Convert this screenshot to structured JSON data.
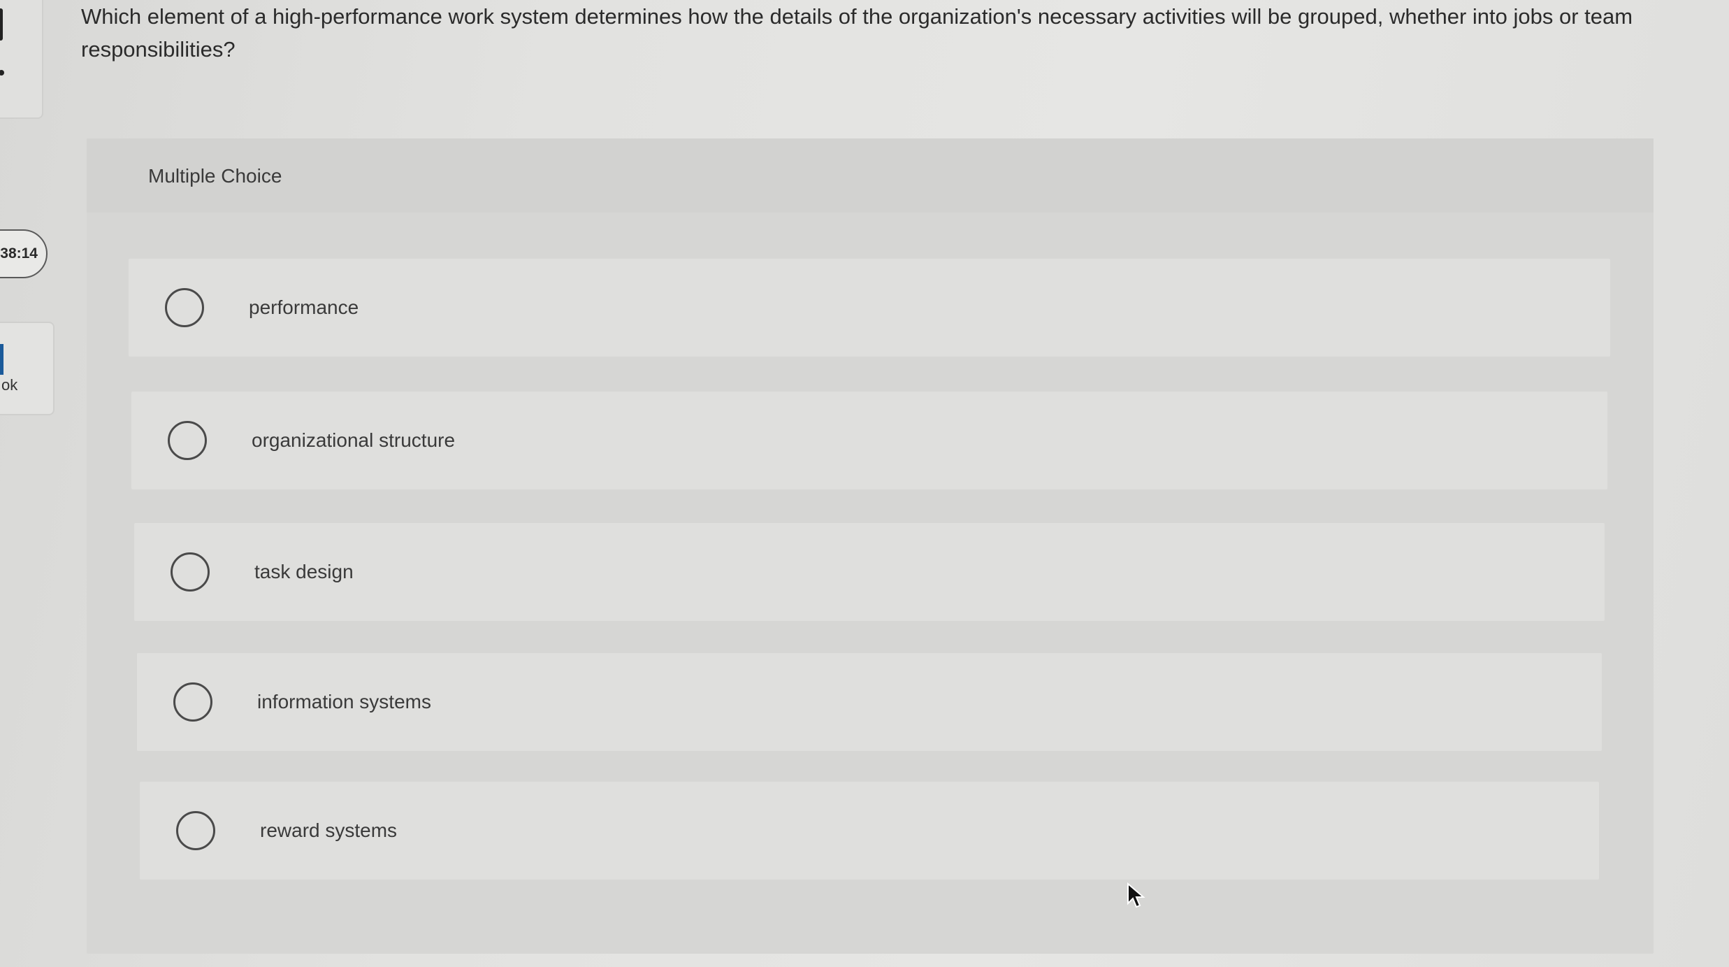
{
  "question": {
    "text": "Which element of a high-performance work system determines how the details of the organization's necessary activities will be grouped, whether into jobs or team responsibilities?"
  },
  "sidebar": {
    "timer": "38:14",
    "ebook_label": "ok"
  },
  "multiple_choice": {
    "title": "Multiple Choice",
    "options": [
      {
        "label": "performance",
        "selected": false
      },
      {
        "label": "organizational structure",
        "selected": false
      },
      {
        "label": "task design",
        "selected": false
      },
      {
        "label": "information systems",
        "selected": false
      },
      {
        "label": "reward systems",
        "selected": false
      }
    ]
  },
  "icons": {
    "radio": "radio-unselected-icon",
    "book": "book-icon",
    "cursor": "mouse-pointer-icon"
  }
}
